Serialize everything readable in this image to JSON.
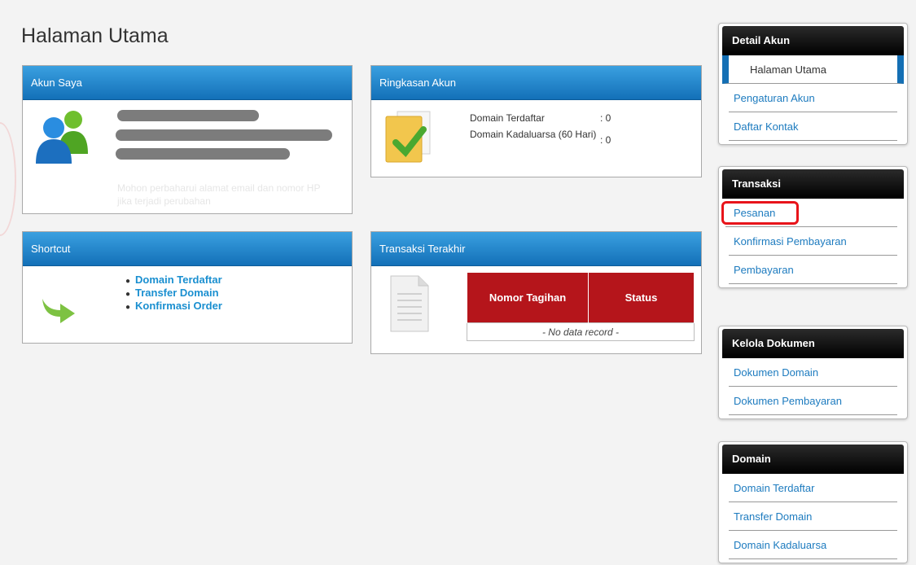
{
  "page": {
    "title": "Halaman Utama"
  },
  "panels": {
    "akun_saya": {
      "title": "Akun Saya",
      "note": "Mohon perbaharui alamat email dan nomor HP jika terjadi perubahan"
    },
    "ringkasan_akun": {
      "title": "Ringkasan Akun",
      "rows": [
        {
          "label": "Domain Terdaftar",
          "value": ": 0"
        },
        {
          "label": "Domain Kadaluarsa (60 Hari)",
          "value": ": 0"
        }
      ]
    },
    "shortcut": {
      "title": "Shortcut",
      "links": [
        "Domain Terdaftar",
        "Transfer Domain",
        "Konfirmasi Order"
      ]
    },
    "transaksi_terakhir": {
      "title": "Transaksi Terakhir",
      "columns": [
        "Nomor Tagihan",
        "Status"
      ],
      "empty": "- No data record -"
    }
  },
  "sidebar": {
    "detail_akun": {
      "title": "Detail Akun",
      "items": [
        "Halaman Utama",
        "Pengaturan Akun",
        "Daftar Kontak"
      ]
    },
    "transaksi": {
      "title": "Transaksi",
      "items": [
        "Pesanan",
        "Konfirmasi Pembayaran",
        "Pembayaran"
      ]
    },
    "kelola_dokumen": {
      "title": "Kelola Dokumen",
      "items": [
        "Dokumen Domain",
        "Dokumen Pembayaran"
      ]
    },
    "domain": {
      "title": "Domain",
      "items": [
        "Domain Terdaftar",
        "Transfer Domain",
        "Domain Kadaluarsa"
      ]
    }
  },
  "colors": {
    "panel_header": "#1a7fcc",
    "sidebar_header": "#111111",
    "link": "#1d7bbf",
    "table_header": "#b5151b",
    "highlight": "#e8141a"
  }
}
